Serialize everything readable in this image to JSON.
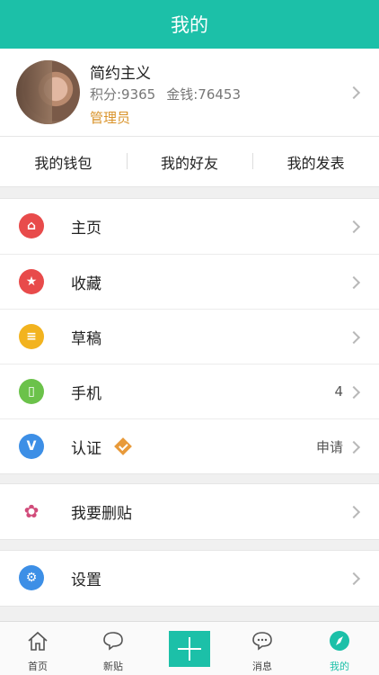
{
  "header": {
    "title": "我的"
  },
  "profile": {
    "name": "简约主义",
    "points": "积分:9365",
    "money": "金钱:76453",
    "role": "管理员"
  },
  "quick_links": [
    "我的钱包",
    "我的好友",
    "我的发表"
  ],
  "menu": {
    "home": {
      "label": "主页",
      "icon": "home-icon",
      "color": "#e84b4b"
    },
    "favorites": {
      "label": "收藏",
      "icon": "star-icon",
      "color": "#e84b4b"
    },
    "drafts": {
      "label": "草稿",
      "icon": "document-icon",
      "color": "#f2b31f"
    },
    "phone": {
      "label": "手机",
      "icon": "phone-icon",
      "color": "#6bc24a",
      "value": "4"
    },
    "verify": {
      "label": "认证",
      "icon": "v-icon",
      "color": "#3d8fe6",
      "value": "申请"
    },
    "delete_post": {
      "label": "我要删贴",
      "icon": "flower-icon",
      "color": "#d14b7a"
    },
    "settings": {
      "label": "设置",
      "icon": "gear-icon",
      "color": "#3d8fe6"
    }
  },
  "tabs": {
    "home": "首页",
    "new_post": "新贴",
    "messages": "消息",
    "mine": "我的"
  },
  "colors": {
    "accent": "#1cc0a8",
    "role": "#d9932a"
  }
}
